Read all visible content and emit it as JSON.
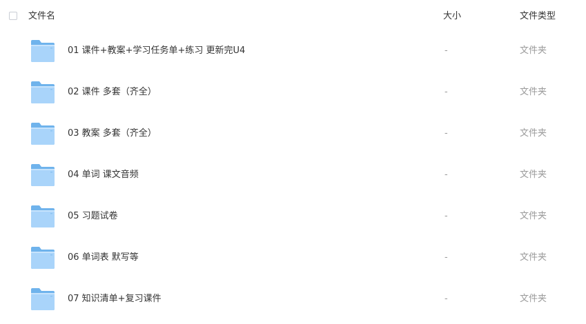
{
  "header": {
    "name_label": "文件名",
    "size_label": "大小",
    "type_label": "文件类型"
  },
  "files": [
    {
      "name": "01 课件+教案+学习任务单+练习 更新完U4",
      "size": "-",
      "type": "文件夹",
      "icon": "folder-icon"
    },
    {
      "name": "02 课件 多套（齐全）",
      "size": "-",
      "type": "文件夹",
      "icon": "folder-icon"
    },
    {
      "name": "03 教案 多套（齐全）",
      "size": "-",
      "type": "文件夹",
      "icon": "folder-icon"
    },
    {
      "name": "04 单词 课文音频",
      "size": "-",
      "type": "文件夹",
      "icon": "folder-icon"
    },
    {
      "name": "05 习题试卷",
      "size": "-",
      "type": "文件夹",
      "icon": "folder-icon"
    },
    {
      "name": "06 单词表 默写等",
      "size": "-",
      "type": "文件夹",
      "icon": "folder-icon"
    },
    {
      "name": "07 知识清单+复习课件",
      "size": "-",
      "type": "文件夹",
      "icon": "folder-icon"
    }
  ],
  "colors": {
    "folder_back": "#6fb3ec",
    "folder_front": "#a9d4fa",
    "muted_text": "#9a9a9a",
    "primary_text": "#333333"
  }
}
